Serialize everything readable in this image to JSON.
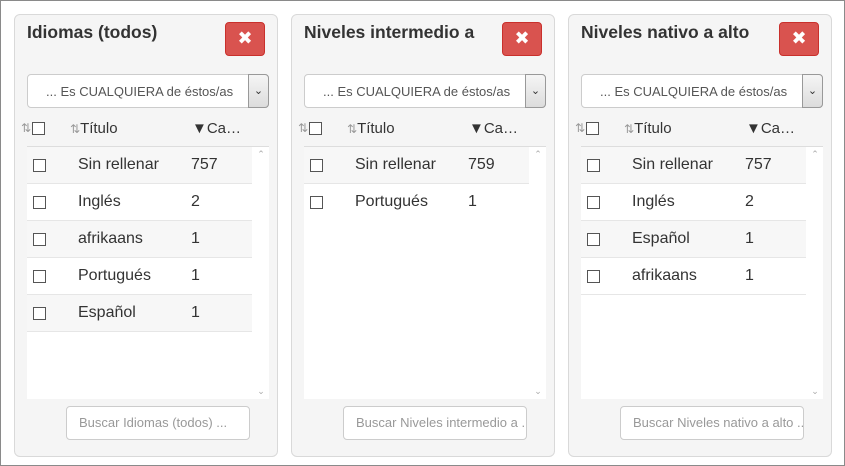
{
  "panes": [
    {
      "title": "Idiomas (todos)",
      "close_label": "✖",
      "mode_value": "... Es CUALQUIERA de éstos/as",
      "mode_arrow": "⌄",
      "headers": {
        "sort_icon": "⇅",
        "title_label": "Título",
        "count_label": "▼Ca…"
      },
      "rows": [
        {
          "label": "Sin rellenar",
          "count": "757"
        },
        {
          "label": "Inglés",
          "count": "2"
        },
        {
          "label": "afrikaans",
          "count": "1"
        },
        {
          "label": "Portugués",
          "count": "1"
        },
        {
          "label": "Español",
          "count": "1"
        }
      ],
      "search_placeholder": "Buscar Idiomas (todos) ..."
    },
    {
      "title": "Niveles intermedio a",
      "close_label": "✖",
      "mode_value": "... Es CUALQUIERA de éstos/as",
      "mode_arrow": "⌄",
      "headers": {
        "sort_icon": "⇅",
        "title_label": "Título",
        "count_label": "▼Ca…"
      },
      "rows": [
        {
          "label": "Sin rellenar",
          "count": "759"
        },
        {
          "label": "Portugués",
          "count": "1"
        }
      ],
      "search_placeholder": "Buscar Niveles intermedio a ..."
    },
    {
      "title": "Niveles nativo a alto",
      "close_label": "✖",
      "mode_value": "... Es CUALQUIERA de éstos/as",
      "mode_arrow": "⌄",
      "headers": {
        "sort_icon": "⇅",
        "title_label": "Título",
        "count_label": "▼Ca…"
      },
      "rows": [
        {
          "label": "Sin rellenar",
          "count": "757"
        },
        {
          "label": "Inglés",
          "count": "2"
        },
        {
          "label": "Español",
          "count": "1"
        },
        {
          "label": "afrikaans",
          "count": "1"
        }
      ],
      "search_placeholder": "Buscar Niveles nativo a alto ..."
    }
  ]
}
